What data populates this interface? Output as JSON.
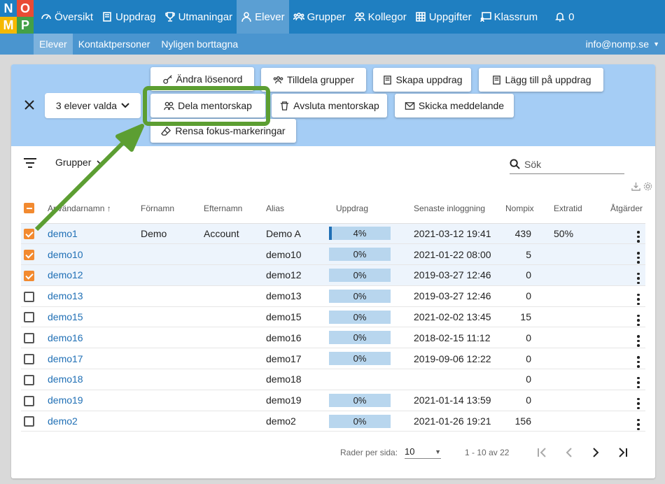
{
  "logo": {
    "letters": [
      "N",
      "O",
      "M",
      "P"
    ],
    "colors": [
      "#1f7fc1",
      "#e94b35",
      "#f5b800",
      "#43a047"
    ]
  },
  "nav": {
    "items": [
      {
        "label": "Översikt",
        "icon": "gauge-icon"
      },
      {
        "label": "Uppdrag",
        "icon": "book-icon"
      },
      {
        "label": "Utmaningar",
        "icon": "trophy-icon"
      },
      {
        "label": "Elever",
        "icon": "user-icon",
        "active": true
      },
      {
        "label": "Grupper",
        "icon": "users-icon"
      },
      {
        "label": "Kollegor",
        "icon": "user-pair-icon"
      },
      {
        "label": "Uppgifter",
        "icon": "grid-icon"
      },
      {
        "label": "Klassrum",
        "icon": "chalkboard-icon"
      },
      {
        "label": "0",
        "icon": "bell-icon"
      }
    ]
  },
  "subnav": {
    "items": [
      "Elever",
      "Kontaktpersoner",
      "Nyligen borttagna"
    ],
    "user": "info@nomp.se"
  },
  "selection": {
    "dropdown_label": "3 elever valda",
    "actions": {
      "change_password": "Ändra lösenord",
      "assign_groups": "Tilldela grupper",
      "create_assignment": "Skapa uppdrag",
      "add_to_assignment": "Lägg till på uppdrag",
      "share_mentorship": "Dela mentorskap",
      "end_mentorship": "Avsluta mentorskap",
      "send_message": "Skicka meddelande",
      "clear_focus": "Rensa fokus-markeringar"
    }
  },
  "filter": {
    "groups_label": "Grupper",
    "search_placeholder": "Sök"
  },
  "table": {
    "headers": [
      "Användarnamn",
      "Förnamn",
      "Efternamn",
      "Alias",
      "Uppdrag",
      "Senaste inloggning",
      "Nompix",
      "Extratid",
      "Åtgärder"
    ],
    "rows": [
      {
        "username": "demo1",
        "first": "Demo",
        "last": "Account",
        "alias": "Demo A",
        "progress": "4%",
        "progress_value": 4,
        "login": "2021-03-12 19:41",
        "nompix": "439",
        "extra": "50%",
        "checked": true
      },
      {
        "username": "demo10",
        "first": "",
        "last": "",
        "alias": "demo10",
        "progress": "0%",
        "progress_value": 0,
        "login": "2021-01-22 08:00",
        "nompix": "5",
        "extra": "",
        "checked": true
      },
      {
        "username": "demo12",
        "first": "",
        "last": "",
        "alias": "demo12",
        "progress": "0%",
        "progress_value": 0,
        "login": "2019-03-27 12:46",
        "nompix": "0",
        "extra": "",
        "checked": true
      },
      {
        "username": "demo13",
        "first": "",
        "last": "",
        "alias": "demo13",
        "progress": "0%",
        "progress_value": 0,
        "login": "2019-03-27 12:46",
        "nompix": "0",
        "extra": "",
        "checked": false
      },
      {
        "username": "demo15",
        "first": "",
        "last": "",
        "alias": "demo15",
        "progress": "0%",
        "progress_value": 0,
        "login": "2021-02-02 13:45",
        "nompix": "15",
        "extra": "",
        "checked": false
      },
      {
        "username": "demo16",
        "first": "",
        "last": "",
        "alias": "demo16",
        "progress": "0%",
        "progress_value": 0,
        "login": "2018-02-15 11:12",
        "nompix": "0",
        "extra": "",
        "checked": false
      },
      {
        "username": "demo17",
        "first": "",
        "last": "",
        "alias": "demo17",
        "progress": "0%",
        "progress_value": 0,
        "login": "2019-09-06 12:22",
        "nompix": "0",
        "extra": "",
        "checked": false
      },
      {
        "username": "demo18",
        "first": "",
        "last": "",
        "alias": "demo18",
        "progress": "",
        "progress_value": null,
        "login": "",
        "nompix": "0",
        "extra": "",
        "checked": false
      },
      {
        "username": "demo19",
        "first": "",
        "last": "",
        "alias": "demo19",
        "progress": "0%",
        "progress_value": 0,
        "login": "2021-01-14 13:59",
        "nompix": "0",
        "extra": "",
        "checked": false
      },
      {
        "username": "demo2",
        "first": "",
        "last": "",
        "alias": "demo2",
        "progress": "0%",
        "progress_value": 0,
        "login": "2021-01-26 19:21",
        "nompix": "156",
        "extra": "",
        "checked": false
      }
    ]
  },
  "pagination": {
    "rows_per_page_label": "Rader per sida:",
    "rows_per_page": "10",
    "range": "1 - 10 av 22"
  },
  "colors": {
    "primary": "#1f7fc1",
    "highlight": "#5c9e32",
    "checkbox": "#f28a30"
  }
}
